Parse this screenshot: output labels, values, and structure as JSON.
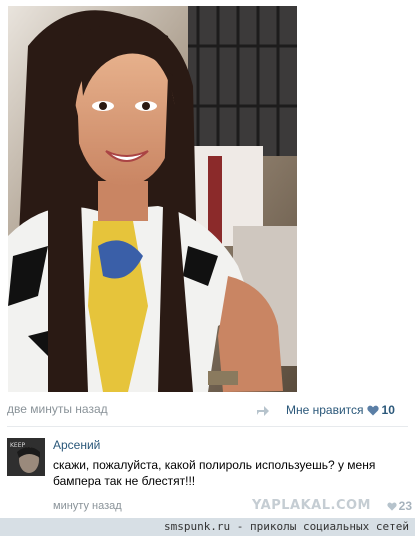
{
  "post": {
    "time": "две минуты назад",
    "like_label": "Мне нравится",
    "like_count": "10"
  },
  "comment": {
    "author": "Арсений",
    "text": "скажи, пожалуйста, какой полироль используешь? у меня бампера так не блестят!!!",
    "time": "минуту назад",
    "like_count": "23",
    "avatar_text": "KEEP"
  },
  "watermark": "YAPLAKAL.COM",
  "footer": "smspunk.ru - приколы социальных сетей",
  "colors": {
    "link": "#2b587a",
    "meta": "#8a9399",
    "footer_bg": "#d7dfe5"
  },
  "icons": [
    "share-icon",
    "heart-icon"
  ]
}
